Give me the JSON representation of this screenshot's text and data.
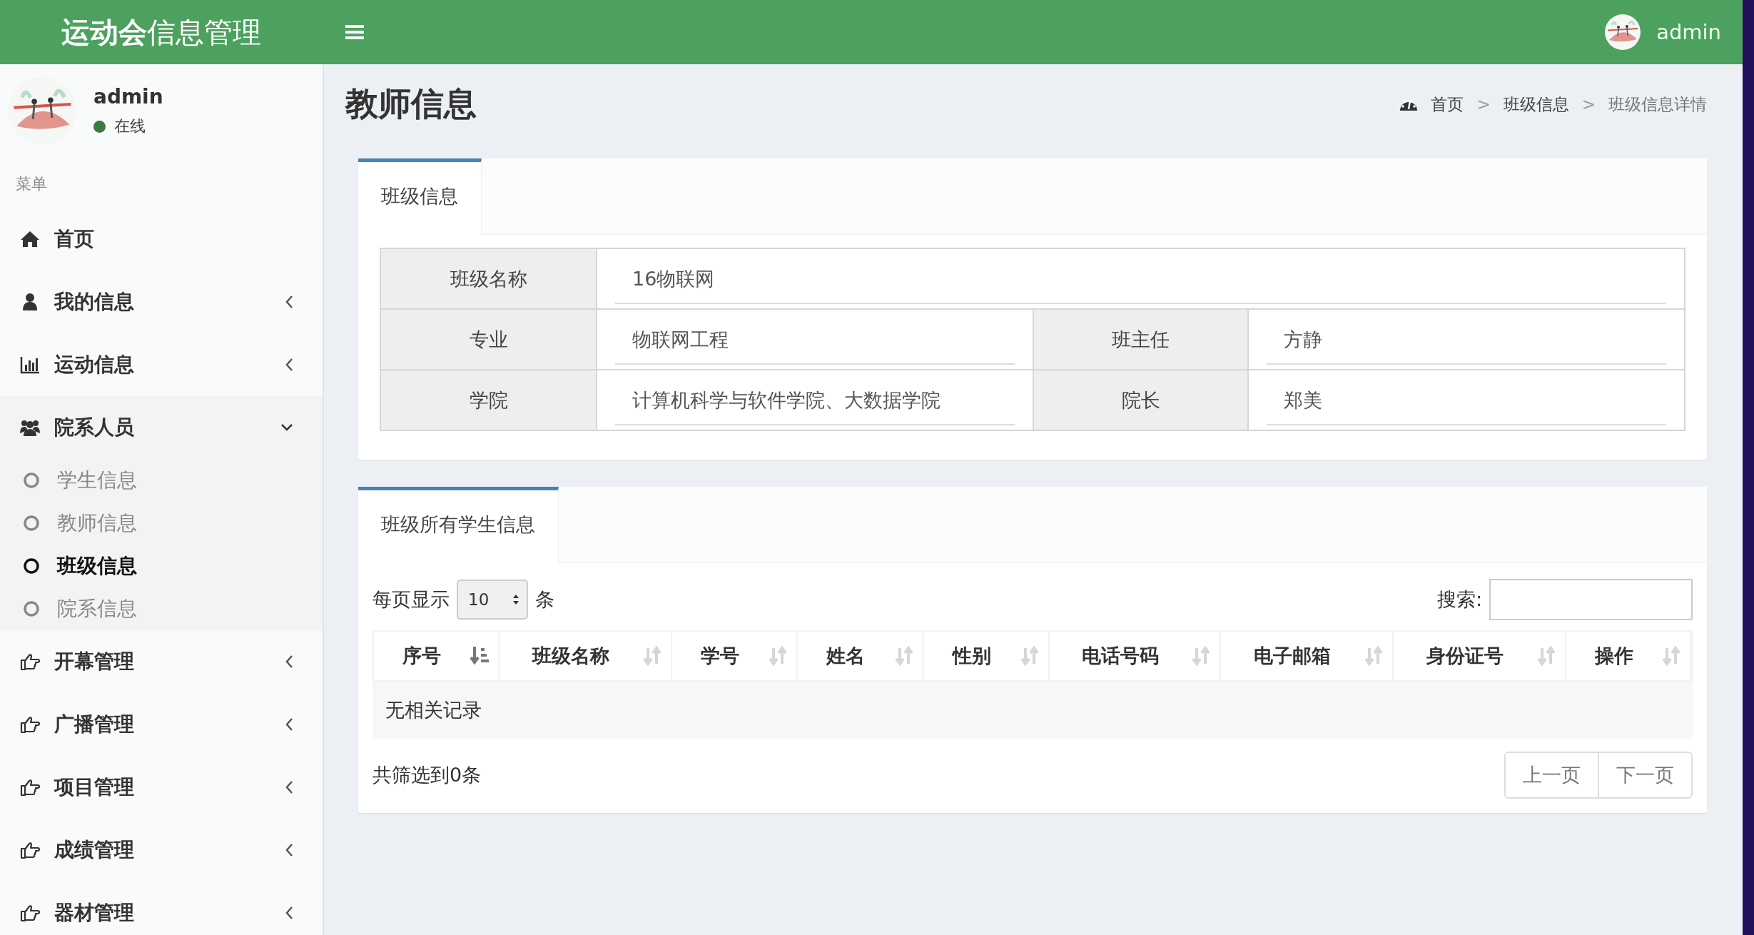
{
  "header": {
    "brand_bold": "运动会",
    "brand_light": "信息管理",
    "user": "admin"
  },
  "user_panel": {
    "name": "admin",
    "status": "在线"
  },
  "sidebar": {
    "heading": "菜单",
    "items": [
      {
        "kind": "home",
        "label": "首页"
      },
      {
        "kind": "user",
        "label": "我的信息",
        "expanded": false
      },
      {
        "kind": "chart",
        "label": "运动信息",
        "expanded": false
      },
      {
        "kind": "users",
        "label": "院系人员",
        "expanded": true,
        "children": [
          {
            "label": "学生信息",
            "selected": false
          },
          {
            "label": "教师信息",
            "selected": false
          },
          {
            "label": "班级信息",
            "selected": true
          },
          {
            "label": "院系信息",
            "selected": false
          }
        ]
      },
      {
        "kind": "hand",
        "label": "开幕管理",
        "expanded": false
      },
      {
        "kind": "hand",
        "label": "广播管理",
        "expanded": false
      },
      {
        "kind": "hand",
        "label": "项目管理",
        "expanded": false
      },
      {
        "kind": "hand",
        "label": "成绩管理",
        "expanded": false
      },
      {
        "kind": "hand",
        "label": "器材管理",
        "expanded": false
      }
    ]
  },
  "page": {
    "title": "教师信息",
    "breadcrumb": [
      {
        "kind": "link",
        "text": "首页"
      },
      {
        "kind": "separator",
        "text": ">"
      },
      {
        "kind": "link",
        "text": "班级信息"
      },
      {
        "kind": "separator",
        "text": ">"
      },
      {
        "kind": "current",
        "text": "班级信息详情"
      }
    ]
  },
  "class_card": {
    "tab": "班级信息",
    "rows": [
      [
        {
          "label": "班级名称",
          "value": "16物联网"
        }
      ],
      [
        {
          "label": "专业",
          "value": "物联网工程"
        },
        {
          "label": "班主任",
          "value": "方静"
        }
      ],
      [
        {
          "label": "学院",
          "value": "计算机科学与软件学院、大数据学院"
        },
        {
          "label": "院长",
          "value": "郑美"
        }
      ]
    ]
  },
  "students_card": {
    "tab": "班级所有学生信息",
    "page_size_label": "每页显示",
    "page_size": "10",
    "page_size_unit": "条",
    "search_label": "搜索:",
    "columns": [
      {
        "label": "序号",
        "sorted": true
      },
      {
        "label": "班级名称",
        "sorted": false
      },
      {
        "label": "学号",
        "sorted": false
      },
      {
        "label": "姓名",
        "sorted": false
      },
      {
        "label": "性别",
        "sorted": false
      },
      {
        "label": "电话号码",
        "sorted": false
      },
      {
        "label": "电子邮箱",
        "sorted": false
      },
      {
        "label": "身份证号",
        "sorted": false
      },
      {
        "label": "操作",
        "sorted": false
      }
    ],
    "empty_text": "无相关记录",
    "summary": "共筛选到0条",
    "pager": [
      {
        "label": "上一页",
        "disabled": true
      },
      {
        "label": "下一页",
        "disabled": true
      }
    ]
  }
}
